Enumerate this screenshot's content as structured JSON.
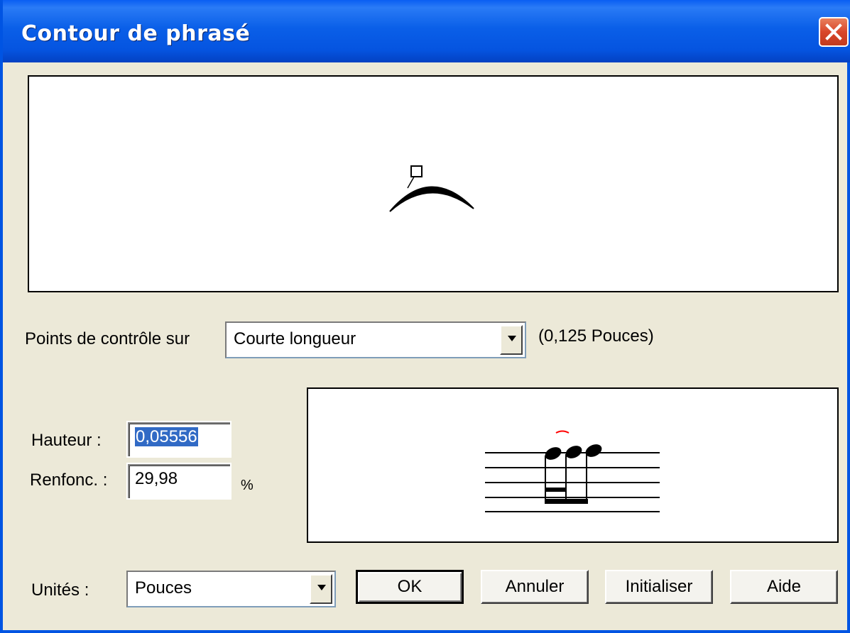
{
  "dialog": {
    "title": "Contour de phrasé"
  },
  "control_points": {
    "label": "Points de contrôle sur",
    "selected": "Courte longueur",
    "info": "(0,125 Pouces)"
  },
  "height": {
    "label": "Hauteur :",
    "value": "0,05556"
  },
  "inset": {
    "label": "Renfonc. :",
    "value": "29,98",
    "unit": "%"
  },
  "units": {
    "label": "Unités :",
    "selected": "Pouces"
  },
  "buttons": {
    "ok": "OK",
    "cancel": "Annuler",
    "reset": "Initialiser",
    "help": "Aide"
  },
  "colors": {
    "title_bar": "#0a5fe8",
    "dialog_bg": "#ece9d8",
    "selection": "#316ac5",
    "close_button": "#d9462a",
    "slur_preview": "#ff0000"
  },
  "icons": {
    "close": "close-x-icon",
    "dropdown": "triangle-down-icon"
  }
}
